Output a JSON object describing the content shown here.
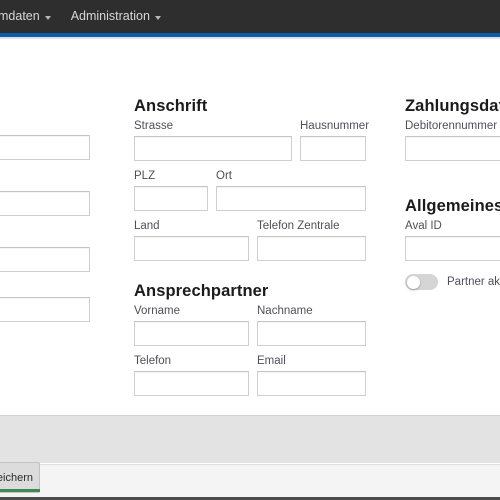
{
  "navbar": {
    "items": [
      {
        "label": "mdaten",
        "caret": "chevron-down-icon"
      },
      {
        "label": "Administration",
        "caret": "chevron-down-icon"
      }
    ],
    "accent_color": "#0d5fae",
    "background_color": "#2e2e2e"
  },
  "form": {
    "left_column": {
      "note": "labels clipped off-screen",
      "fields": [
        {
          "value": ""
        },
        {
          "value": ""
        },
        {
          "value": ""
        },
        {
          "value": ""
        }
      ]
    },
    "sections": [
      {
        "title": "Anschrift",
        "fields": [
          {
            "label": "Strasse",
            "value": ""
          },
          {
            "label": "Hausnummer",
            "value": ""
          },
          {
            "label": "PLZ",
            "value": ""
          },
          {
            "label": "Ort",
            "value": ""
          },
          {
            "label": "Land",
            "value": ""
          },
          {
            "label": "Telefon Zentrale",
            "value": ""
          }
        ]
      },
      {
        "title": "Ansprechpartner",
        "fields": [
          {
            "label": "Vorname",
            "value": ""
          },
          {
            "label": "Nachname",
            "value": ""
          },
          {
            "label": "Telefon",
            "value": ""
          },
          {
            "label": "Email",
            "value": ""
          }
        ]
      },
      {
        "title": "Zahlungsdaten",
        "fields": [
          {
            "label": "Debitorennummer",
            "value": ""
          }
        ]
      },
      {
        "title": "Allgemeines",
        "fields": [
          {
            "label": "Aval ID",
            "value": ""
          }
        ],
        "toggle": {
          "label": "Partner aktiv",
          "state": "off"
        }
      }
    ]
  },
  "download_shelf": {
    "item_label": "peichern",
    "progress_color": "#3f8a54"
  }
}
